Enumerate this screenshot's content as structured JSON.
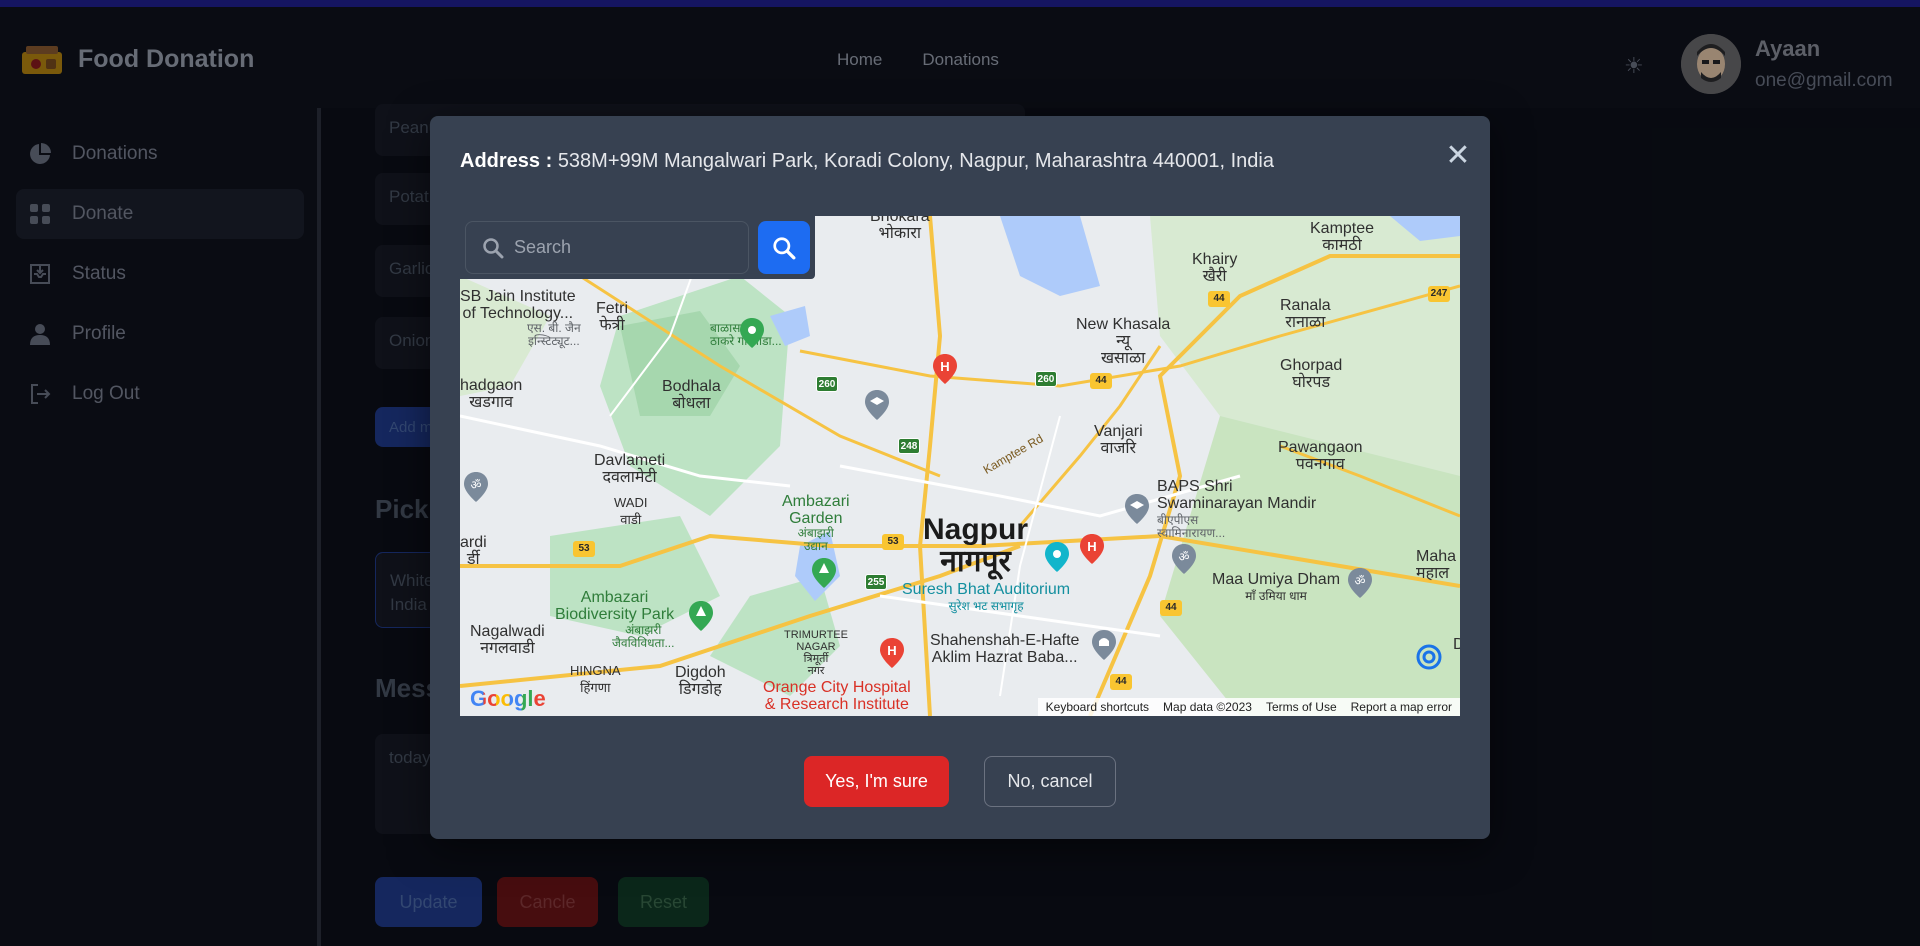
{
  "app": {
    "title": "Food Donation"
  },
  "nav": {
    "home": "Home",
    "donations": "Donations"
  },
  "user": {
    "name": "Ayaan",
    "email": "one@gmail.com"
  },
  "sidebar": {
    "items": [
      {
        "label": "Donations",
        "icon": "pie-chart-icon"
      },
      {
        "label": "Donate",
        "icon": "grid-icon",
        "active": true
      },
      {
        "label": "Status",
        "icon": "inbox-icon"
      },
      {
        "label": "Profile",
        "icon": "user-icon"
      },
      {
        "label": "Log Out",
        "icon": "logout-icon"
      }
    ]
  },
  "background_form": {
    "items": [
      "Peanu",
      "Potat",
      "Garlic",
      "Onion"
    ],
    "add_more": "Add m",
    "pickup_heading": "PickU",
    "pickup_value_line1": "White",
    "pickup_value_line2": "India",
    "message_heading": "Mess",
    "message_value": "today",
    "update_label": "Update",
    "cancel_label": "Cancle",
    "reset_label": "Reset"
  },
  "modal": {
    "address_label": "Address :",
    "address_value": "538M+99M Mangalwari Park, Koradi Colony, Nagpur, Maharashtra 440001, India",
    "search_placeholder": "Search",
    "confirm_label": "Yes, I'm sure",
    "cancel_label": "No, cancel"
  },
  "map": {
    "labels": {
      "bhokara": "Bhokara",
      "bhokara_mr": "भोकारा",
      "kamptee": "Kamptee",
      "kamptee_mr": "कामठी",
      "khairy": "Khairy",
      "khairy_mr": "खैरी",
      "ranala": "Ranala",
      "ranala_mr": "रानाळा",
      "sb_jain_1": "SB Jain Institute",
      "sb_jain_2": "of Technology...",
      "sb_jain_mr1": "एस. बी. जैन",
      "sb_jain_mr2": "इन्स्टिट्यूट...",
      "fetri": "Fetri",
      "fetri_mr": "फेत्री",
      "balasaheb_1": "बाळासाहेब",
      "balasaheb_2": "ठाकरे गोरेवाडा...",
      "new_khasala": "New Khasala",
      "new_khasala_mr1": "न्यू",
      "new_khasala_mr2": "खसाळा",
      "ghorpad": "Ghorpad",
      "ghorpad_mr": "घोरपड",
      "hadgaon": "hadgaon",
      "hadgaon_mr": "खडगाव",
      "bodhala": "Bodhala",
      "bodhala_mr": "बोधला",
      "vanjari": "Vanjari",
      "vanjari_mr": "वाजरि",
      "pawangaon": "Pawangaon",
      "pawangaon_mr": "पवनगाव",
      "davlameti": "Davlameti",
      "davlameti_mr": "दवलामेटी",
      "wadi": "WADI",
      "wadi_mr": "वाडी",
      "kamptee_rd": "Kamptee Rd",
      "baps_1": "BAPS Shri",
      "baps_2": "Swaminarayan Mandir",
      "baps_mr1": "बीएपीएस",
      "baps_mr2": "स्वामिनारायण...",
      "ardi": "ardi",
      "ardi_mr": "र्डी",
      "ambazari_garden": "Ambazari",
      "ambazari_garden_2": "Garden",
      "ambazari_garden_mr1": "अंबाझरी",
      "ambazari_garden_mr2": "उद्यान",
      "nagpur": "Nagpur",
      "nagpur_mr": "नागपूर",
      "maha": "Maha",
      "maha_mr": "महाल",
      "maa_umiya": "Maa Umiya Dham",
      "maa_umiya_mr": "माँ उमिया धाम",
      "suresh_bhat": "Suresh Bhat Auditorium",
      "suresh_bhat_mr": "सुरेश भट सभागृह",
      "ambazari_bio_1": "Ambazari",
      "ambazari_bio_2": "Biodiversity Park",
      "ambazari_bio_mr1": "अंबाझरी",
      "ambazari_bio_mr2": "जैवविविधता...",
      "nagalwadi": "Nagalwadi",
      "nagalwadi_mr": "नगलवाडी",
      "trimurtee_1": "TRIMURTEE",
      "trimurtee_2": "NAGAR",
      "trimurtee_mr1": "त्रिमूर्ती",
      "trimurtee_mr2": "नगर",
      "shahenshah_1": "Shahenshah-E-Hafte",
      "shahenshah_2": "Aklim Hazrat Baba...",
      "hingna": "HINGNA",
      "hingna_mr": "हिंगणा",
      "digdoh": "Digdoh",
      "digdoh_mr": "डिगडोह",
      "orange_city_1": "Orange City Hospital",
      "orange_city_2": "& Research Institute",
      "d_edge": "D"
    },
    "shields": {
      "s247": "247",
      "s44a": "44",
      "s260a": "260",
      "s260b": "260",
      "s44b": "44",
      "s248": "248",
      "s53a": "53",
      "s53b": "53",
      "s255": "255",
      "s44c": "44",
      "s44d": "44"
    },
    "footer": {
      "keyboard": "Keyboard shortcuts",
      "mapdata": "Map data ©2023",
      "terms": "Terms of Use",
      "report": "Report a map error"
    },
    "google": "Google"
  },
  "colors": {
    "accent_blue": "#1d6cf2",
    "danger_red": "#dc2626",
    "modal_bg": "#374151",
    "page_bg": "#0a0d14"
  }
}
